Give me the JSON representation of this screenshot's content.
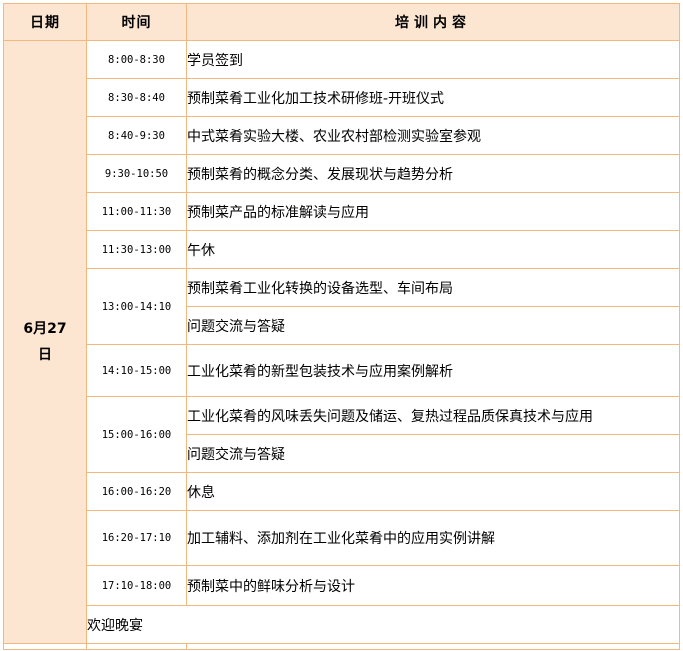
{
  "header": {
    "date_label": "日期",
    "time_label": "时间",
    "content_label": "培训内容"
  },
  "date": {
    "line1": "6月27",
    "line2": "日"
  },
  "rows": [
    {
      "time": "8:00-8:30",
      "items": [
        "学员签到"
      ]
    },
    {
      "time": "8:30-8:40",
      "items": [
        "预制菜肴工业化加工技术研修班-开班仪式"
      ]
    },
    {
      "time": "8:40-9:30",
      "items": [
        "中式菜肴实验大楼、农业农村部检测实验室参观"
      ]
    },
    {
      "time": "9:30-10:50",
      "items": [
        "预制菜肴的概念分类、发展现状与趋势分析"
      ]
    },
    {
      "time": "11:00-11:30",
      "items": [
        "预制菜产品的标准解读与应用"
      ]
    },
    {
      "time": "11:30-13:00",
      "items": [
        "午休"
      ]
    },
    {
      "time": "13:00-14:10",
      "items": [
        "预制菜肴工业化转换的设备选型、车间布局",
        "问题交流与答疑"
      ]
    },
    {
      "time": "14:10-15:00",
      "items": [
        "工业化菜肴的新型包装技术与应用案例解析"
      ]
    },
    {
      "time": "15:00-16:00",
      "items": [
        "工业化菜肴的风味丢失问题及储运、复热过程品质保真技术与应用",
        "问题交流与答疑"
      ]
    },
    {
      "time": "16:00-16:20",
      "items": [
        "休息"
      ]
    },
    {
      "time": "16:20-17:10",
      "items": [
        "加工辅料、添加剂在工业化菜肴中的应用实例讲解"
      ]
    },
    {
      "time": "17:10-18:00",
      "items": [
        "预制菜中的鲜味分析与设计"
      ]
    }
  ],
  "welcome": "欢迎晚宴",
  "colors": {
    "border": "#f3b87d",
    "header_bg": "#fde6d1"
  }
}
